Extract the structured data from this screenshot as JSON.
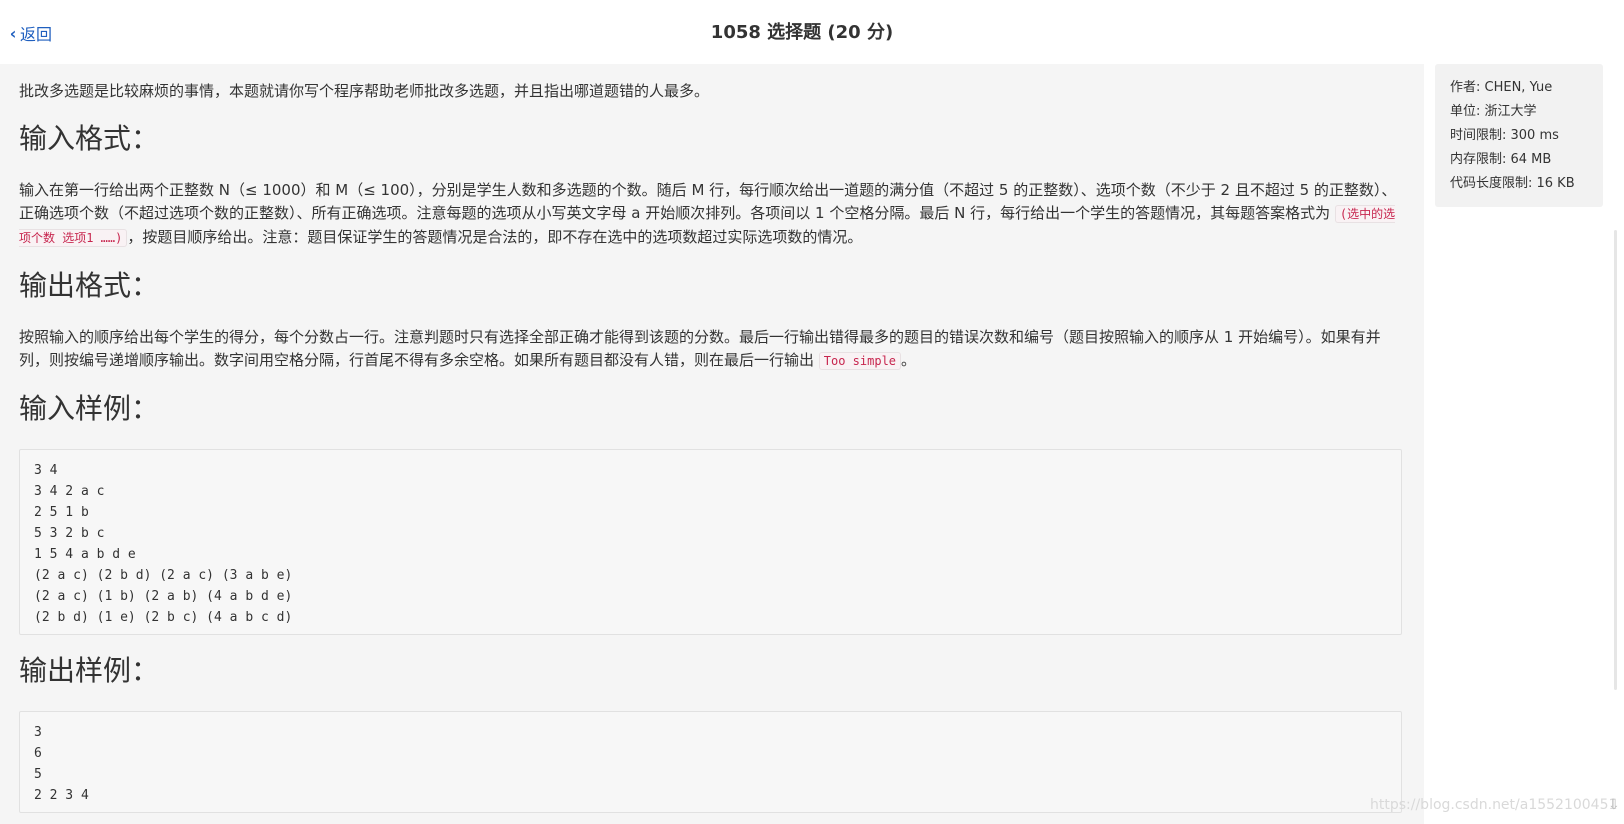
{
  "header": {
    "back_label": "返回",
    "title": "1058 选择题 (20 分)"
  },
  "problem": {
    "intro": "批改多选题是比较麻烦的事情，本题就请你写个程序帮助老师批改多选题，并且指出哪道题错的人最多。",
    "input_heading": "输入格式：",
    "input_text_before": "输入在第一行给出两个正整数 N（≤ 1000）和 M（≤ 100），分别是学生人数和多选题的个数。随后 M 行，每行顺次给出一道题的满分值（不超过 5 的正整数）、选项个数（不少于 2 且不超过 5 的正整数）、正确选项个数（不超过选项个数的正整数）、所有正确选项。注意每题的选项从小写英文字母 a 开始顺次排列。各项间以 1 个空格分隔。最后 N 行，每行给出一个学生的答题情况，其每题答案格式为 ",
    "input_code": "(选中的选项个数 选项1 ……)",
    "input_text_after": "，按题目顺序给出。注意：题目保证学生的答题情况是合法的，即不存在选中的选项数超过实际选项数的情况。",
    "output_heading": "输出格式：",
    "output_text_before": "按照输入的顺序给出每个学生的得分，每个分数占一行。注意判题时只有选择全部正确才能得到该题的分数。最后一行输出错得最多的题目的错误次数和编号（题目按照输入的顺序从 1 开始编号）。如果有并列，则按编号递增顺序输出。数字间用空格分隔，行首尾不得有多余空格。如果所有题目都没有人错，则在最后一行输出 ",
    "output_code": "Too simple",
    "output_text_after": "。",
    "sample_input_heading": "输入样例：",
    "sample_input_lines": [
      "3 4",
      "3 4 2 a c",
      "2 5 1 b",
      "5 3 2 b c",
      "1 5 4 a b d e",
      "(2 a c) (2 b d) (2 a c) (3 a b e)",
      "(2 a c) (1 b) (2 a b) (4 a b d e)",
      "(2 b d) (1 e) (2 b c) (4 a b c d)"
    ],
    "sample_output_heading": "输出样例：",
    "sample_output_lines": [
      "3",
      "6",
      "5",
      "2 2 3 4"
    ]
  },
  "info": {
    "author": "作者: CHEN, Yue",
    "unit": "单位: 浙江大学",
    "time_limit": "时间限制: 300 ms",
    "memory_limit": "内存限制: 64 MB",
    "code_limit": "代码长度限制: 16 KB"
  },
  "watermark": "https://blog.csdn.net/a1552100451",
  "colors": {
    "link": "#1f5fbf",
    "panel_bg": "#f5f5f5",
    "code_red": "#c7254e"
  }
}
